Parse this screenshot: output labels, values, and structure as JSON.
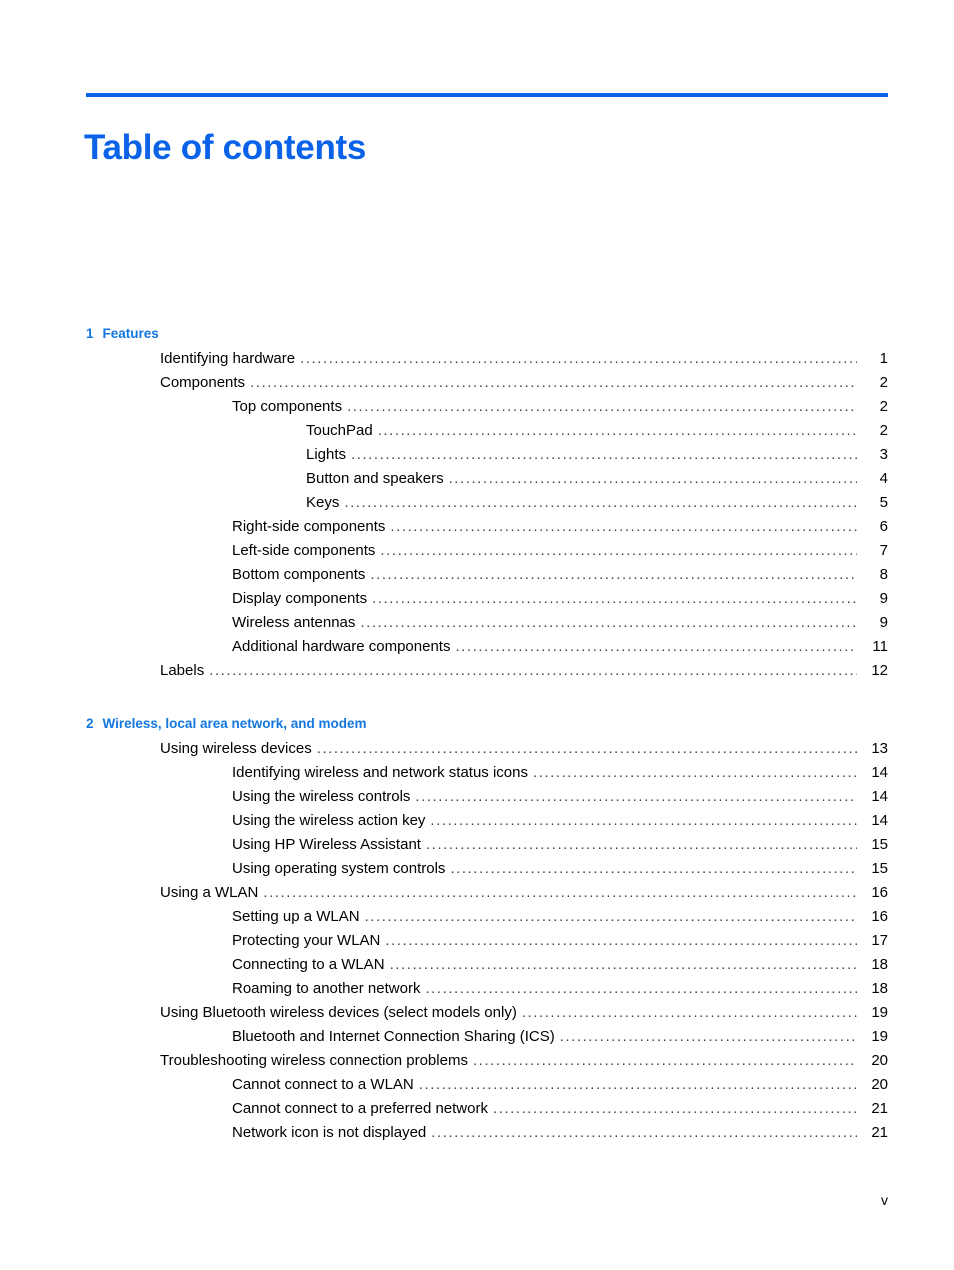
{
  "document": {
    "title": "Table of contents",
    "folio": "v",
    "accent_color": "#0a62e8",
    "heading_color": "#1477e0"
  },
  "chapters": [
    {
      "number": "1",
      "title": "Features",
      "entries": [
        {
          "level": 1,
          "label": "Identifying hardware",
          "page": "1"
        },
        {
          "level": 1,
          "label": "Components",
          "page": "2"
        },
        {
          "level": 2,
          "label": "Top components",
          "page": "2"
        },
        {
          "level": 3,
          "label": "TouchPad",
          "page": "2"
        },
        {
          "level": 3,
          "label": "Lights",
          "page": "3"
        },
        {
          "level": 3,
          "label": "Button and speakers",
          "page": "4"
        },
        {
          "level": 3,
          "label": "Keys",
          "page": "5"
        },
        {
          "level": 2,
          "label": "Right-side components",
          "page": "6"
        },
        {
          "level": 2,
          "label": "Left-side components",
          "page": "7"
        },
        {
          "level": 2,
          "label": "Bottom components",
          "page": "8"
        },
        {
          "level": 2,
          "label": "Display components",
          "page": "9"
        },
        {
          "level": 2,
          "label": "Wireless antennas",
          "page": "9"
        },
        {
          "level": 2,
          "label": "Additional hardware components",
          "page": "11"
        },
        {
          "level": 1,
          "label": "Labels",
          "page": "12"
        }
      ]
    },
    {
      "number": "2",
      "title": "Wireless, local area network, and modem",
      "entries": [
        {
          "level": 1,
          "label": "Using wireless devices",
          "page": "13"
        },
        {
          "level": 2,
          "label": "Identifying wireless and network status icons",
          "page": "14"
        },
        {
          "level": 2,
          "label": "Using the wireless controls",
          "page": "14"
        },
        {
          "level": 2,
          "label": "Using the wireless action key",
          "page": "14"
        },
        {
          "level": 2,
          "label": "Using HP Wireless Assistant",
          "page": "15"
        },
        {
          "level": 2,
          "label": "Using operating system controls",
          "page": "15"
        },
        {
          "level": 1,
          "label": "Using a WLAN",
          "page": "16"
        },
        {
          "level": 2,
          "label": "Setting up a WLAN",
          "page": "16"
        },
        {
          "level": 2,
          "label": "Protecting your WLAN",
          "page": "17"
        },
        {
          "level": 2,
          "label": "Connecting to a WLAN",
          "page": "18"
        },
        {
          "level": 2,
          "label": "Roaming to another network",
          "page": "18"
        },
        {
          "level": 1,
          "label": "Using Bluetooth wireless devices (select models only)",
          "page": "19"
        },
        {
          "level": 2,
          "label": "Bluetooth and Internet Connection Sharing (ICS)",
          "page": "19"
        },
        {
          "level": 1,
          "label": "Troubleshooting wireless connection problems",
          "page": "20"
        },
        {
          "level": 2,
          "label": "Cannot connect to a WLAN",
          "page": "20"
        },
        {
          "level": 2,
          "label": "Cannot connect to a preferred network",
          "page": "21"
        },
        {
          "level": 2,
          "label": "Network icon is not displayed",
          "page": "21"
        }
      ]
    }
  ]
}
